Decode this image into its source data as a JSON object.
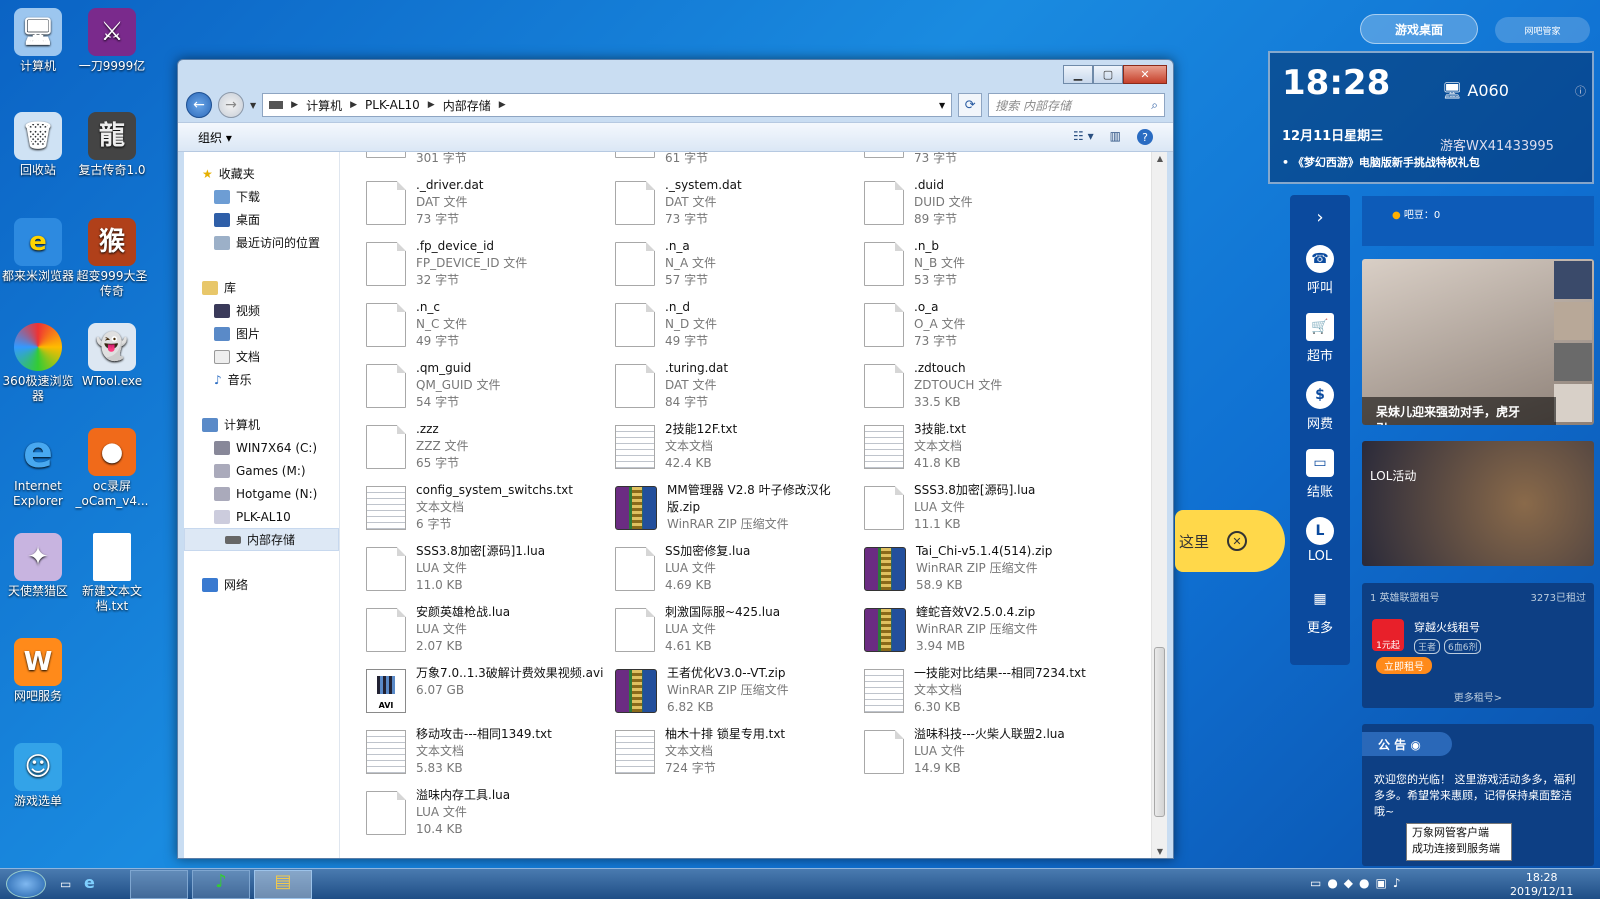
{
  "desktop_icons": [
    {
      "label": "计算机",
      "icon": "computer-icon"
    },
    {
      "label": "一刀9999亿",
      "icon": "game-icon"
    },
    {
      "label": "回收站",
      "icon": "recycle-bin-icon"
    },
    {
      "label": "复古传奇1.0",
      "icon": "game-icon"
    },
    {
      "label": "都来米浏览器",
      "icon": "browser-icon"
    },
    {
      "label": "超变999大圣传奇",
      "icon": "game-icon"
    },
    {
      "label": "360极速浏览器",
      "icon": "browser-icon"
    },
    {
      "label": "WTool.exe",
      "icon": "ghost-icon"
    },
    {
      "label": "Internet Explorer",
      "icon": "ie-icon"
    },
    {
      "label": "oc录屏 _oCam_v4...",
      "icon": "record-icon"
    },
    {
      "label": "天使禁猎区",
      "icon": "game-icon"
    },
    {
      "label": "新建文本文档.txt",
      "icon": "text-file-icon"
    },
    {
      "label": "网吧服务",
      "icon": "service-icon"
    },
    {
      "label": "游戏选单",
      "icon": "menu-icon"
    }
  ],
  "explorer": {
    "breadcrumb": [
      "计算机",
      "PLK-AL10",
      "内部存储"
    ],
    "search_placeholder": "搜索 内部存储",
    "toolbar_organize": "组织 ▾",
    "nav": {
      "favorites": "收藏夹",
      "fav_items": [
        "下载",
        "桌面",
        "最近访问的位置"
      ],
      "library": "库",
      "lib_items": [
        "视频",
        "图片",
        "文档",
        "音乐"
      ],
      "computer": "计算机",
      "drives": [
        "WIN7X64 (C:)",
        "Games (M:)",
        "Hotgame (N:)",
        "PLK-AL10"
      ],
      "selected": "内部存储",
      "network": "网络"
    },
    "top_partial": [
      "301 字节",
      "61 字节",
      "73 字节"
    ],
    "files": [
      {
        "name": "._driver.dat",
        "type": "DAT 文件",
        "size": "73 字节",
        "icon": "doc"
      },
      {
        "name": "._system.dat",
        "type": "DAT 文件",
        "size": "73 字节",
        "icon": "doc"
      },
      {
        "name": ".duid",
        "type": "DUID 文件",
        "size": "89 字节",
        "icon": "doc"
      },
      {
        "name": ".fp_device_id",
        "type": "FP_DEVICE_ID 文件",
        "size": "32 字节",
        "icon": "doc"
      },
      {
        "name": ".n_a",
        "type": "N_A 文件",
        "size": "57 字节",
        "icon": "doc"
      },
      {
        "name": ".n_b",
        "type": "N_B 文件",
        "size": "53 字节",
        "icon": "doc"
      },
      {
        "name": ".n_c",
        "type": "N_C 文件",
        "size": "49 字节",
        "icon": "doc"
      },
      {
        "name": ".n_d",
        "type": "N_D 文件",
        "size": "49 字节",
        "icon": "doc"
      },
      {
        "name": ".o_a",
        "type": "O_A 文件",
        "size": "73 字节",
        "icon": "doc"
      },
      {
        "name": ".qm_guid",
        "type": "QM_GUID 文件",
        "size": "54 字节",
        "icon": "doc"
      },
      {
        "name": ".turing.dat",
        "type": "DAT 文件",
        "size": "84 字节",
        "icon": "doc"
      },
      {
        "name": ".zdtouch",
        "type": "ZDTOUCH 文件",
        "size": "33.5 KB",
        "icon": "doc"
      },
      {
        "name": ".zzz",
        "type": "ZZZ 文件",
        "size": "65 字节",
        "icon": "doc"
      },
      {
        "name": "2技能12F.txt",
        "type": "文本文档",
        "size": "42.4 KB",
        "icon": "txt"
      },
      {
        "name": "3技能.txt",
        "type": "文本文档",
        "size": "41.8 KB",
        "icon": "txt"
      },
      {
        "name": "config_system_switchs.txt",
        "type": "文本文档",
        "size": "6 字节",
        "icon": "txt"
      },
      {
        "name": "MM管理器 V2.8 叶子修改汉化版.zip",
        "type": "WinRAR ZIP 压缩文件",
        "size": "",
        "icon": "zip"
      },
      {
        "name": "SSS3.8加密[源码].lua",
        "type": "LUA 文件",
        "size": "11.1 KB",
        "icon": "doc"
      },
      {
        "name": "SSS3.8加密[源码]1.lua",
        "type": "LUA 文件",
        "size": "11.0 KB",
        "icon": "doc"
      },
      {
        "name": "SS加密修复.lua",
        "type": "LUA 文件",
        "size": "4.69 KB",
        "icon": "doc"
      },
      {
        "name": "Tai_Chi-v5.1.4(514).zip",
        "type": "WinRAR ZIP 压缩文件",
        "size": "58.9 KB",
        "icon": "zip"
      },
      {
        "name": "安颜英雄枪战.lua",
        "type": "LUA 文件",
        "size": "2.07 KB",
        "icon": "doc"
      },
      {
        "name": "刺激国际服~425.lua",
        "type": "LUA 文件",
        "size": "4.61 KB",
        "icon": "doc"
      },
      {
        "name": "蝰蛇音效V2.5.0.4.zip",
        "type": "WinRAR ZIP 压缩文件",
        "size": "3.94 MB",
        "icon": "zip"
      },
      {
        "name": "万象7.0..1.3破解计费效果视频.avi",
        "type": "6.07 GB",
        "size": "",
        "icon": "avi"
      },
      {
        "name": "王者优化V3.0--VT.zip",
        "type": "WinRAR ZIP 压缩文件",
        "size": "6.82 KB",
        "icon": "zip"
      },
      {
        "name": "一技能对比结果---相同7234.txt",
        "type": "文本文档",
        "size": "6.30 KB",
        "icon": "txt"
      },
      {
        "name": "移动攻击---相同1349.txt",
        "type": "文本文档",
        "size": "5.83 KB",
        "icon": "txt"
      },
      {
        "name": "柚木十排 锁星专用.txt",
        "type": "文本文档",
        "size": "724 字节",
        "icon": "txt"
      },
      {
        "name": "溢味科技---火柴人联盟2.lua",
        "type": "LUA 文件",
        "size": "14.9 KB",
        "icon": "doc"
      },
      {
        "name": "溢味内存工具.lua",
        "type": "LUA 文件",
        "size": "10.4 KB",
        "icon": "doc"
      }
    ]
  },
  "popup": {
    "label": "这里"
  },
  "sidebar": {
    "top_button": "游戏桌面",
    "top_right": "网吧管家",
    "time": "18:28",
    "seat": "A060",
    "date": "12月11日星期三",
    "user": "游客WX41433995",
    "news": "《梦幻西游》电脑版新手挑战特权礼包",
    "beans": "吧豆：0",
    "nav": [
      "呼叫",
      "超市",
      "网费",
      "结账",
      "LOL",
      "更多"
    ],
    "banner_caption": "呆妹儿迎来强劲对手，虎牙引...",
    "lol_label": "LOL活动",
    "rent_title": "1 英雄联盟租号",
    "rent_count": "3273已租过",
    "rent_item": "穿越火线租号",
    "rent_price": "1元起",
    "rent_tags": [
      "王者",
      "6血6剂"
    ],
    "rent_button": "立即租号",
    "rent_more": "更多租号>",
    "notice_title": "公 告",
    "notice_text": "欢迎您的光临！ 这里游戏活动多多，福利多多。希望常来惠顾，记得保持桌面整洁哦~",
    "tooltip_line1": "万象网管客户端",
    "tooltip_line2": "成功连接到服务端"
  },
  "taskbar": {
    "time": "18:28",
    "date": "2019/12/11"
  }
}
